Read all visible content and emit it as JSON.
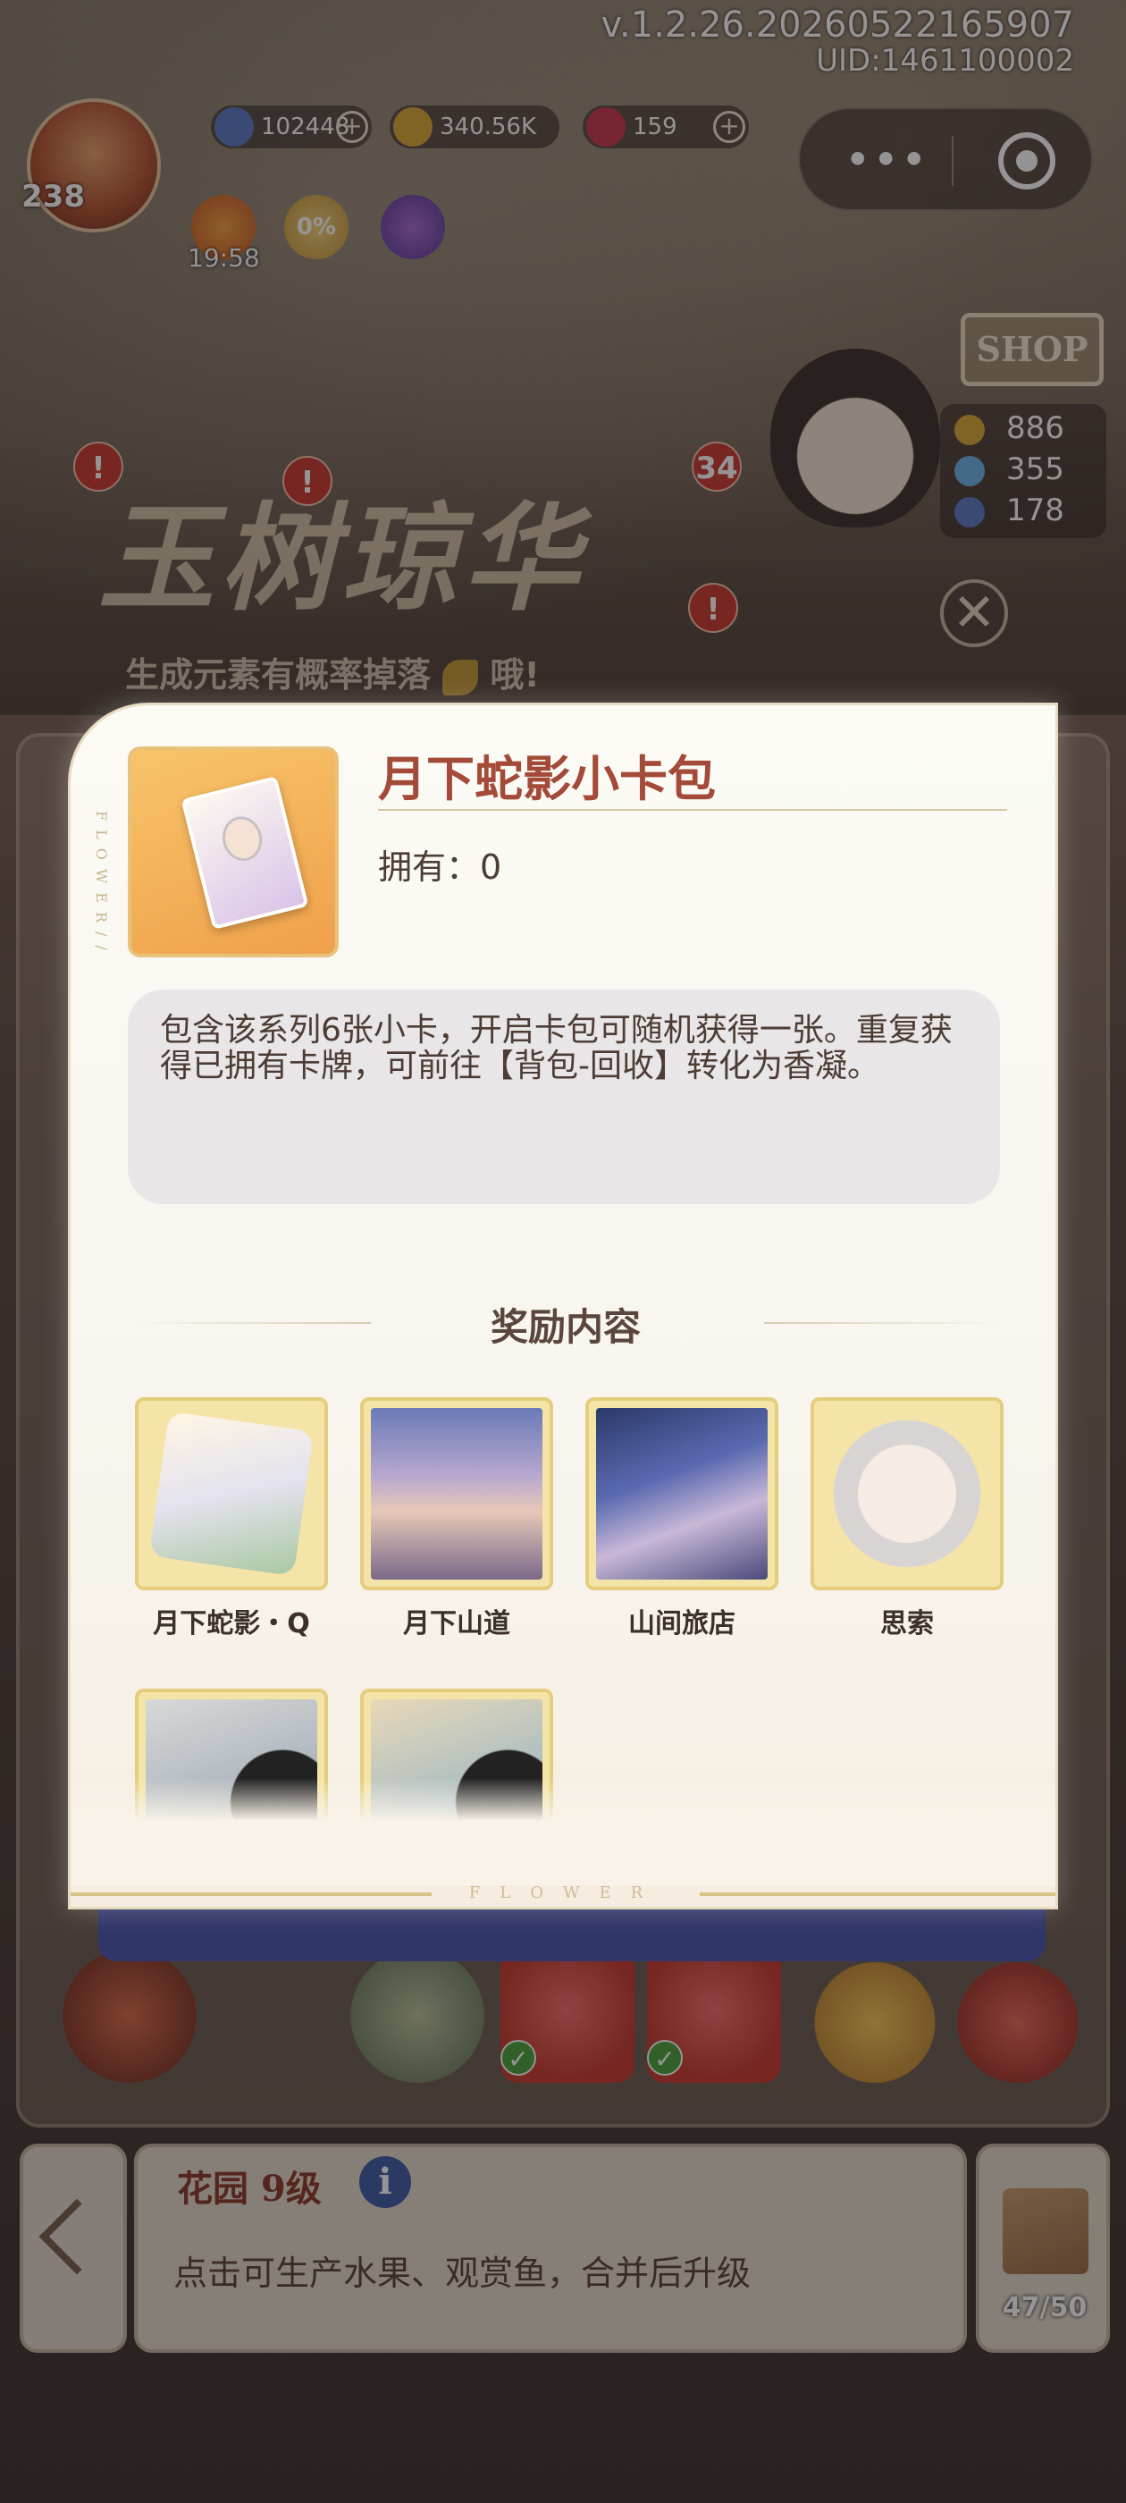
{
  "status": {
    "version": "v.1.2.26.20260522165907",
    "uid": "UID:1461100002"
  },
  "player": {
    "level": "238",
    "energy": "102448",
    "coins": "340.56K",
    "gems": "159",
    "timer": "19:58",
    "bonus_percent": "0%"
  },
  "capsule": {
    "more": "•••"
  },
  "shop": {
    "sign": "SHOP",
    "stats": [
      "886",
      "355",
      "178"
    ]
  },
  "banner": {
    "title": "玉树琼华",
    "subtitle": "生成元素有概率掉落",
    "subtitle_end": "哦!",
    "notify_count": "34",
    "notify_mark": "!",
    "close": "✕"
  },
  "modal": {
    "title": "月下蛇影小卡包",
    "owned": "拥有：0",
    "description": "包含该系列6张小卡，开启卡包可随机获得一张。重复获得已拥有卡牌，可前往【背包-回收】转化为香凝。",
    "rewards_heading": "奖励内容",
    "side_text": "FLOWER//",
    "bottom_text": "FLOWER",
    "rewards": [
      {
        "label": "月下蛇影・Q",
        "art": "card"
      },
      {
        "label": "月下山道",
        "art": "landscape"
      },
      {
        "label": "山间旅店",
        "art": "interior"
      },
      {
        "label": "思索",
        "art": "portrait"
      },
      {
        "label": "",
        "art": "record"
      },
      {
        "label": "",
        "art": "record"
      }
    ]
  },
  "garden": {
    "title": "花园 9级",
    "info": "i",
    "description": "点击可生产水果、观赏鱼，合并后升级",
    "inventory": "47/50"
  },
  "colors": {
    "modal_title": "#a44a38",
    "reward_frame": "#f5e4a8",
    "check": "#4aa43c"
  }
}
